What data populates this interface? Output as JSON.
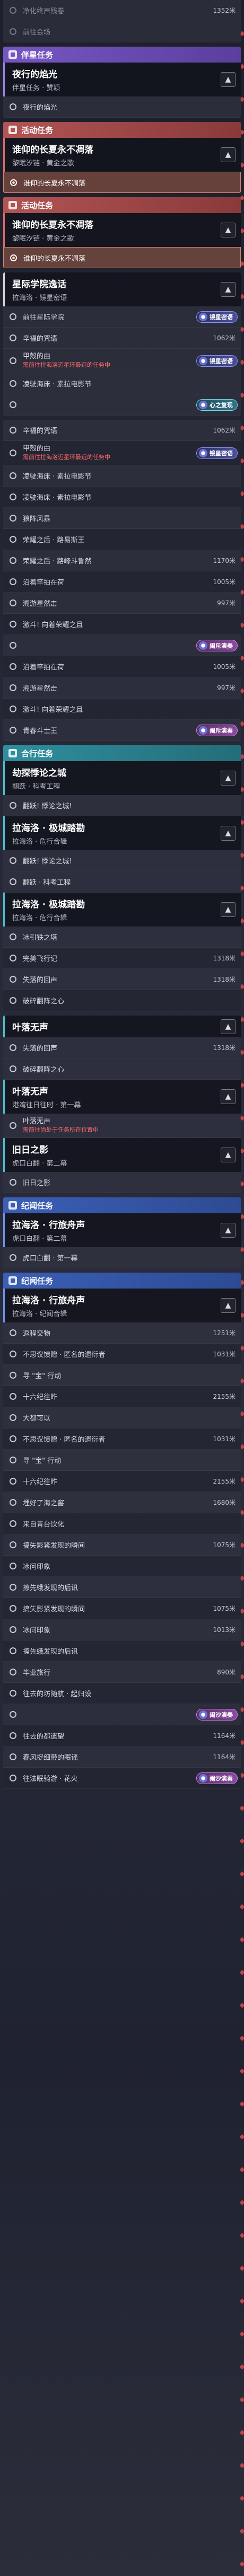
{
  "top_rows": [
    {
      "label": "净化终声残卷",
      "dist": "1352米"
    },
    {
      "label": "前往会场",
      "dist": ""
    }
  ],
  "sec1": {
    "header": "伴星任务",
    "quest_title": "夜行的焰光",
    "quest_sub": "伴星任务 · 赞颖",
    "rows": [
      {
        "label": "夜行的焰光"
      }
    ]
  },
  "sec2": {
    "header": "活动任务",
    "quest_title": "谁仰的长夏永不凋落",
    "quest_sub": "黎眠汐链 · 黄金之歌",
    "rows": [
      {
        "label": "谁仰的长夏永不凋落",
        "highlight": true
      }
    ]
  },
  "sec3": {
    "header": "活动任务",
    "quest_title": "谁仰的长夏永不凋落",
    "quest_sub": "黎眠汐链 · 黄金之歌",
    "rows": [
      {
        "label": "谁仰的长夏永不凋落",
        "highlight": true
      }
    ]
  },
  "sec4": {
    "quest_title": "星际学院逸话",
    "quest_sub": "拉海洛 · 镜星密语",
    "rows": [
      {
        "label": "前往星际学院",
        "dist": "",
        "badge": "镜星密语"
      },
      {
        "label": "辛福的咒语",
        "dist": "1062米"
      },
      {
        "label": "甲殼的由",
        "warn": "需前往拉海洛迈星环最远的任务中",
        "badge": "镜星密语"
      },
      {
        "label": "凌驶海床 · 素拉电影节",
        "dist": ""
      },
      {
        "label": "",
        "dist": "",
        "badge": "心之复现",
        "teal": true
      }
    ]
  },
  "sec4b": {
    "rows": [
      {
        "label": "辛福的咒语",
        "dist": "1062米"
      },
      {
        "label": "甲殼的由",
        "warn": "需前往拉海洛迈星环最远的任务中",
        "badge": "镜星密语"
      },
      {
        "label": "凌驶海床 · 素拉电影节",
        "dist": ""
      },
      {
        "label": "凌驶海床 · 素拉电影节",
        "dist": ""
      },
      {
        "label": "狼阵风暴",
        "dist": ""
      },
      {
        "label": "荣耀之后 · 路易斯王",
        "dist": ""
      },
      {
        "label": "荣耀之后 · 路峰斗鲁然",
        "dist": "1170米"
      },
      {
        "label": "沿着竿拍在荷",
        "dist": "1005米"
      },
      {
        "label": "溯游星然击",
        "dist": "997米"
      },
      {
        "label": "激斗! 向着荣耀之且",
        "dist": ""
      },
      {
        "label": "",
        "dist": "",
        "badge": "闹斥演奏",
        "pink": true
      },
      {
        "label": "沿着竿拍在荷",
        "dist": "1005米"
      },
      {
        "label": "溯游星然击",
        "dist": "997米"
      },
      {
        "label": "激斗! 向着荣耀之且",
        "dist": ""
      },
      {
        "label": "青春斗士王",
        "dist": "",
        "badge": "闹斥演奏",
        "pink": true
      }
    ]
  },
  "sec5": {
    "header": "合行任务",
    "quest_title": "劫探悸论之城",
    "quest_sub": "翻跃 · 科考工程",
    "rows": [
      {
        "label": "翻跃! 悸论之城!",
        "dist": ""
      }
    ],
    "quest2_title": "拉海洛 · 极城踏勘",
    "quest2_sub": "拉海洛 · 危行合辑",
    "rows2": [
      {
        "label": "翻跃! 悸论之城!",
        "dist": ""
      },
      {
        "label": "翻跃 · 科考工程",
        "dist": ""
      }
    ],
    "quest3_title": "拉海洛 · 极城踏勘",
    "quest3_sub": "拉海洛 · 危行合辑",
    "rows3": [
      {
        "label": "冰引铁之塔",
        "dist": ""
      },
      {
        "label": "完美飞行记",
        "dist": "1318米"
      },
      {
        "label": "失落的回声",
        "dist": "1318米"
      },
      {
        "label": "破碎翻阵之心",
        "dist": ""
      }
    ]
  },
  "sec6": {
    "quest_title": "叶落无声",
    "quest_sub": "",
    "rows": [
      {
        "label": "失落的回声",
        "dist": "1318米"
      },
      {
        "label": "破碎翻阵之心",
        "dist": ""
      }
    ],
    "quest2_title": "叶落无声",
    "quest2_sub": "港湾往日往时 · 第一幕",
    "rows2": [
      {
        "label": "叶落无声",
        "warn": "需前往尚处于任务所在位置中"
      }
    ],
    "quest3_title": "旧日之影",
    "quest3_sub": "虎口白翻 · 第二幕",
    "rows3": [
      {
        "label": "旧日之影",
        "dist": ""
      }
    ]
  },
  "sec7": {
    "header": "纪闻任务",
    "quest_title": "拉海洛 · 行旅舟声",
    "quest_sub": "虎口白翻 · 第二幕",
    "rows": [
      {
        "label": "虎口白翻 · 第一幕",
        "dist": ""
      }
    ]
  },
  "sec8": {
    "header": "纪闻任务",
    "quest_title": "拉海洛 · 行旅舟声",
    "quest_sub": "拉海洛 · 纪闻合辑",
    "rows": [
      {
        "label": "返程交物",
        "dist": "1251米"
      },
      {
        "label": "不思议馈赠 · 匿名的遗衍者",
        "dist": "1031米"
      },
      {
        "label": "寻 \"宝\" 行动",
        "dist": ""
      },
      {
        "label": "十六纪往昨",
        "dist": "2155米"
      },
      {
        "label": "大都可以",
        "dist": ""
      },
      {
        "label": "不思议馈赠 · 匿名的遗衍者",
        "dist": "1031米"
      },
      {
        "label": "寻 \"宝\" 行动",
        "dist": ""
      },
      {
        "label": "十六纪往昨",
        "dist": "2155米"
      },
      {
        "label": "埋好了海之窖",
        "dist": "1680米"
      },
      {
        "label": "来自青台饮化",
        "dist": ""
      },
      {
        "label": "搞失影紧发现的瞬间",
        "dist": "1075米"
      },
      {
        "label": "冰问印象",
        "dist": ""
      },
      {
        "label": "擦先蛾发现的后讯",
        "dist": ""
      },
      {
        "label": "搞失影紧发现的瞬间",
        "dist": "1075米"
      },
      {
        "label": "冰问印象",
        "dist": "1013米"
      },
      {
        "label": "擦先蛾发现的后讯",
        "dist": ""
      },
      {
        "label": "毕业旅行",
        "dist": "890米"
      },
      {
        "label": "往去的坊随航 · 起归设",
        "dist": ""
      },
      {
        "label": "",
        "dist": "",
        "badge": "闹沙演奏",
        "pink": true
      },
      {
        "label": "往去的都遗望",
        "dist": "1164米"
      },
      {
        "label": "春风捉细带的眠谣",
        "dist": "1164米"
      },
      {
        "label": "往法眠骑游 · 花火",
        "dist": "",
        "badge": "闹沙演奏",
        "pink": true
      }
    ]
  }
}
